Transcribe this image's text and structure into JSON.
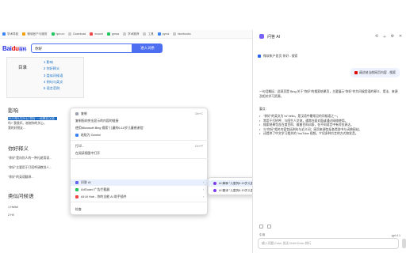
{
  "bookmarks": [
    {
      "label": "学术导航",
      "color": "#3b82f6"
    },
    {
      "label": "微软帐户与服务",
      "color": "#f59e0b"
    },
    {
      "label": "hpn.cn",
      "color": "#22c55e"
    },
    {
      "label": "Download",
      "color": "#c9c9c9"
    },
    {
      "label": "ecoum",
      "color": "#ef4444"
    },
    {
      "label": "gmaa",
      "color": "#22c55e"
    },
    {
      "label": "学术推荐",
      "color": "#c9c9c9"
    },
    {
      "label": "工具",
      "color": "#c9c9c9"
    },
    {
      "label": "pynoi",
      "color": "#3b82f6"
    },
    {
      "label": "facebooks",
      "color": "#c9c9c9"
    }
  ],
  "search": {
    "logo_main": "Bai",
    "logo_du": "du",
    "logo_suffix": "百科",
    "query": "你好",
    "button": "进入词条"
  },
  "article": {
    "toc_title": "目录",
    "toc_items": [
      "1 影响",
      "2 你好释义",
      "3 类似问候语",
      "4 例句与英文",
      "5 语言范例"
    ],
    "section_influence": "影响",
    "influence_highlight": "2023年5月28日 你好 一词来自汉语...",
    "influence_text_1": "吗? 我很好。谢谢你的关心。",
    "influence_text_2": "我的好朋友...",
    "section_meaning": "你好释义",
    "meaning_1": "\"你好\"是向别人的一种礼貌用语...",
    "meaning_2": "\"你好\"主要用于打招呼请教别人...",
    "meaning_3": "\"你好\"的英语翻译...",
    "section_similar": "类似问候语",
    "similar_1": "1 Hello!",
    "similar_2": "2 Hi!"
  },
  "context_menu": {
    "items": [
      {
        "label": "复制",
        "shortcut": "Ctrl+C"
      },
      {
        "label": "复制指向突出显示的内容的链接",
        "shortcut": ""
      },
      {
        "label": "使用Microsoft Bing 搜索\"儿童的6-10岁儿童感谢信\"",
        "shortcut": ""
      },
      {
        "label": "粘贴为 Gemini",
        "shortcut": ""
      },
      {
        "label": "打印...",
        "shortcut": "Ctrl+P"
      },
      {
        "label": "在阅读视图中打开",
        "shortcut": ""
      },
      {
        "label": "问答 AI",
        "shortcut": ""
      },
      {
        "label": "AdGuard 广告拦截器",
        "shortcut": ""
      },
      {
        "label": "All AI Hub - 你的全能 AI 助手插件",
        "shortcut": ""
      },
      {
        "label": "检查",
        "shortcut": ""
      }
    ]
  },
  "submenu": {
    "items": [
      "AI 解释 \"儿童的6-10岁儿童感谢信\"",
      "AI 翻译 \"儿童的6-10岁儿童感谢信\""
    ]
  },
  "panel": {
    "title": "问答 AI",
    "tab_title": "微软帐户首页 你好 - 搜索",
    "user_message": "请总结当前网页内容 - 搜索",
    "answer_intro": "一句话概括：此网页是 Bing 关于\"你好\"的搜索结果页，主要展示\"你好\"作为问候用语的释义、用法、来源及相关学习资源。",
    "answer_heading": "要点：",
    "answer_points": [
      "\"你好\"的英文为 hi/ hello，是汉语中最常见的问候语之一。",
      "常用于打招呼、与陌生人交流，通常在面对面或通过网络使用。",
      "搜索结果包含百度百科、维基百科词条，在不同语言中有对应表达。",
      "与\"你好\"相关内容包括例句与近义词；网页来源包括各类辞书与词典网站。",
      "还提供了中文学习相关的 YouTube 视频，介绍多种方言的方式和发音。"
    ],
    "quick_label": "引用",
    "model": "gpt-4.1",
    "input_placeholder": "输入问题,Enter 发送,Shift+Enter 换行"
  }
}
